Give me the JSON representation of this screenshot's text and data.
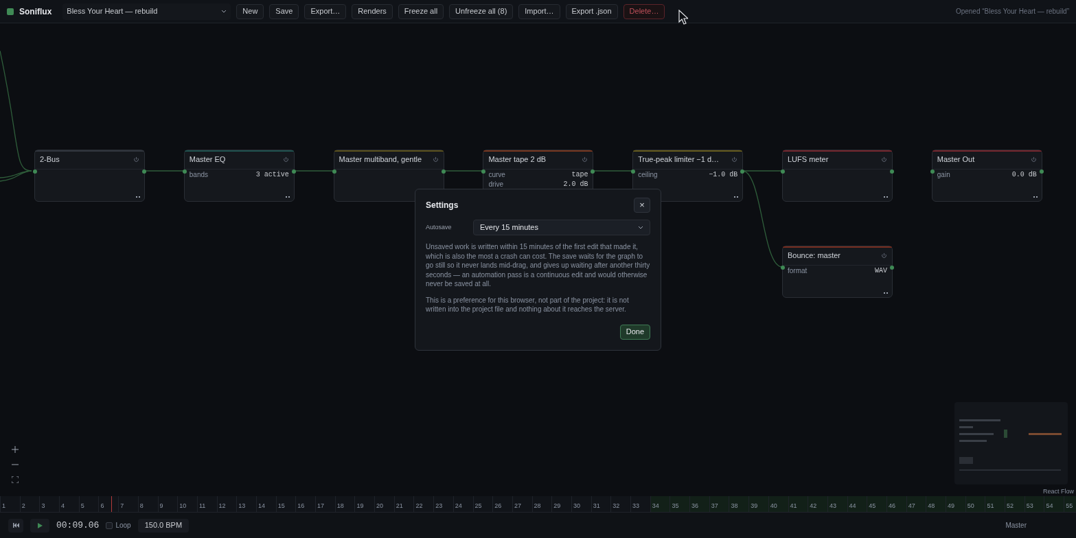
{
  "app": {
    "name": "Soniflux"
  },
  "toolbar": {
    "project": "Bless Your Heart — rebuild",
    "buttons": [
      {
        "label": "New",
        "kind": "normal"
      },
      {
        "label": "Save",
        "kind": "normal"
      },
      {
        "label": "Export…",
        "kind": "normal"
      },
      {
        "label": "Renders",
        "kind": "normal"
      },
      {
        "label": "Freeze all",
        "kind": "normal"
      },
      {
        "label": "Unfreeze all (8)",
        "kind": "normal"
      },
      {
        "label": "Import…",
        "kind": "normal"
      },
      {
        "label": "Export .json",
        "kind": "normal"
      },
      {
        "label": "Delete…",
        "kind": "danger"
      }
    ],
    "status": "Opened “Bless Your Heart — rebuild”"
  },
  "nodes": [
    {
      "title": "2-Bus",
      "color": "#30353d"
    },
    {
      "title": "Master EQ",
      "color": "#1f514e",
      "params": [
        {
          "name": "bands",
          "value": "3 active"
        }
      ]
    },
    {
      "title": "Master multiband, gentle",
      "color": "#5a501c"
    },
    {
      "title": "Master tape 2 dB",
      "color": "#76361f",
      "params": [
        {
          "name": "curve",
          "value": "tape"
        },
        {
          "name": "drive",
          "value": "2.0 dB"
        }
      ]
    },
    {
      "title": "True-peak limiter −1 d…",
      "color": "#645a1c",
      "params": [
        {
          "name": "ceiling",
          "value": "−1.0 dB"
        }
      ]
    },
    {
      "title": "LUFS meter",
      "color": "#74262d"
    },
    {
      "title": "Master Out",
      "color": "#74262d",
      "params": [
        {
          "name": "gain",
          "value": "0.0 dB"
        }
      ]
    }
  ],
  "branch_nodes": [
    {
      "title": "Bounce: master",
      "color": "#762c1f",
      "params": [
        {
          "name": "format",
          "value": "WAV"
        }
      ]
    }
  ],
  "canvas": {
    "attribution": "React Flow"
  },
  "timeline": {
    "bars": [
      "1",
      "2",
      "3",
      "4",
      "5",
      "6",
      "7",
      "8",
      "9",
      "10",
      "11",
      "12",
      "13",
      "14",
      "15",
      "16",
      "17",
      "18",
      "19",
      "20",
      "21",
      "22",
      "23",
      "24",
      "25",
      "26",
      "27",
      "28",
      "29",
      "30",
      "31",
      "32",
      "33",
      "34",
      "35",
      "36",
      "37",
      "38",
      "39",
      "40",
      "41",
      "42",
      "43",
      "44",
      "45",
      "46",
      "47",
      "48",
      "49",
      "50",
      "51",
      "52",
      "53",
      "54",
      "55"
    ]
  },
  "transport": {
    "time": "00:09.06",
    "loop": {
      "label": "Loop",
      "checked": false
    },
    "tempo": "150.0 BPM",
    "track": "Master"
  },
  "dialog": {
    "title": "Settings",
    "field_label": "Autosave",
    "value": "Every 15 minutes",
    "paragraphs": [
      "Unsaved work is written within 15 minutes of the first edit that made it, which is also the most a crash can cost. The save waits for the graph to go still so it never lands mid-drag, and gives up waiting after another thirty seconds — an automation pass is a continuous edit and would otherwise never be saved at all.",
      "This is a preference for this browser, not part of the project: it is not written into the project file and nothing about it reaches the server."
    ],
    "close": "×",
    "done": "Done"
  }
}
